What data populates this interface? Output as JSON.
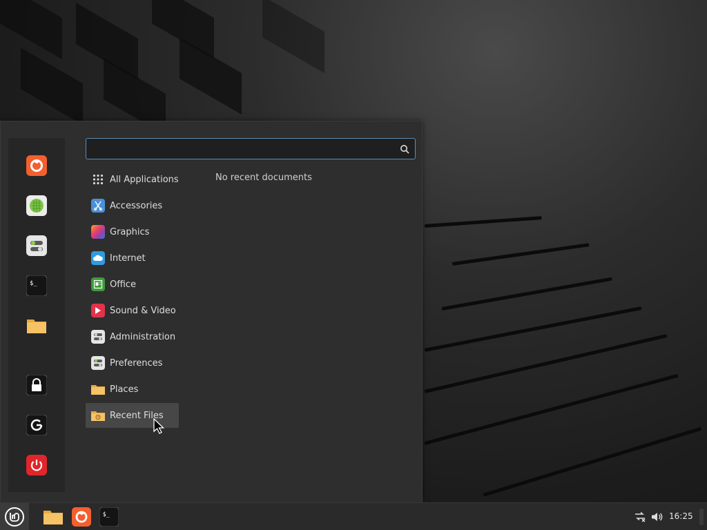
{
  "menu": {
    "search": {
      "value": "",
      "placeholder": ""
    },
    "categories": [
      {
        "label": "All Applications",
        "icon": "grid-icon"
      },
      {
        "label": "Accessories",
        "icon": "scissors-icon"
      },
      {
        "label": "Graphics",
        "icon": "graphics-icon"
      },
      {
        "label": "Internet",
        "icon": "cloud-icon"
      },
      {
        "label": "Office",
        "icon": "office-icon"
      },
      {
        "label": "Sound & Video",
        "icon": "play-icon"
      },
      {
        "label": "Administration",
        "icon": "admin-toggles-icon"
      },
      {
        "label": "Preferences",
        "icon": "preferences-toggles-icon"
      },
      {
        "label": "Places",
        "icon": "folder-icon"
      },
      {
        "label": "Recent Files",
        "icon": "recent-folder-icon"
      }
    ],
    "selected_category": "Recent Files",
    "content_message": "No recent documents",
    "favorites": [
      {
        "name": "firefox",
        "icon": "firefox-icon"
      },
      {
        "name": "software-manager",
        "icon": "software-manager-icon"
      },
      {
        "name": "settings",
        "icon": "settings-toggles-icon"
      },
      {
        "name": "terminal",
        "icon": "terminal-icon"
      },
      {
        "name": "files",
        "icon": "folder-icon"
      }
    ],
    "session": [
      {
        "name": "lock-screen",
        "icon": "lock-icon"
      },
      {
        "name": "logout",
        "icon": "logout-icon"
      },
      {
        "name": "shutdown",
        "icon": "power-icon"
      }
    ]
  },
  "panel": {
    "clock": "16:25",
    "launchers": [
      "files",
      "firefox",
      "terminal"
    ],
    "tray": [
      "network-disconnected-icon",
      "volume-icon"
    ]
  },
  "colors": {
    "accent": "#5c8fb8",
    "firefox": "#f2602f",
    "shutdown": "#e0262a",
    "folder": "#f5c266"
  }
}
